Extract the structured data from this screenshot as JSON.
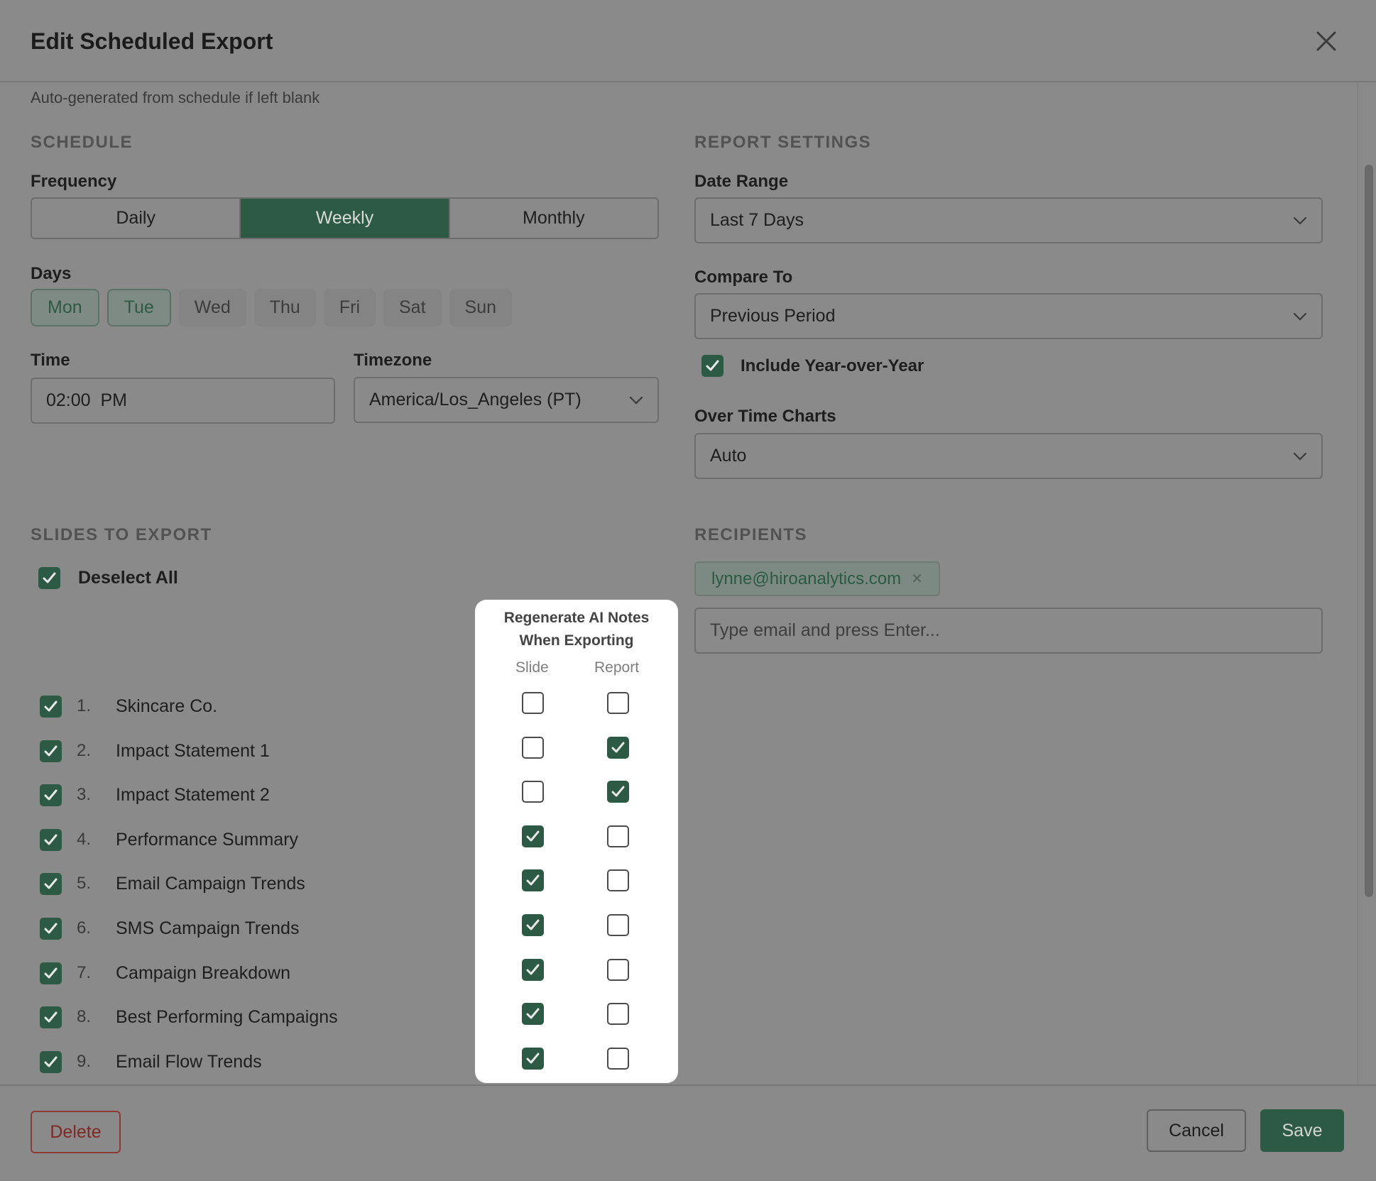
{
  "dialog": {
    "title": "Edit Scheduled Export",
    "name_hint": "Auto-generated from schedule if left blank"
  },
  "schedule": {
    "heading": "SCHEDULE",
    "frequency_label": "Frequency",
    "frequency_options": [
      "Daily",
      "Weekly",
      "Monthly"
    ],
    "frequency_selected": "Weekly",
    "days_label": "Days",
    "days": [
      {
        "label": "Mon",
        "selected": true
      },
      {
        "label": "Tue",
        "selected": true
      },
      {
        "label": "Wed",
        "selected": false
      },
      {
        "label": "Thu",
        "selected": false
      },
      {
        "label": "Fri",
        "selected": false
      },
      {
        "label": "Sat",
        "selected": false
      },
      {
        "label": "Sun",
        "selected": false
      }
    ],
    "time_label": "Time",
    "time_value": "02:00  PM",
    "timezone_label": "Timezone",
    "timezone_value": "America/Los_Angeles (PT)"
  },
  "report_settings": {
    "heading": "REPORT SETTINGS",
    "date_range_label": "Date Range",
    "date_range_value": "Last 7 Days",
    "compare_label": "Compare To",
    "compare_value": "Previous Period",
    "yoy_label": "Include Year-over-Year",
    "yoy_checked": true,
    "over_time_label": "Over Time Charts",
    "over_time_value": "Auto"
  },
  "slides": {
    "heading": "SLIDES TO EXPORT",
    "deselect_label": "Deselect All",
    "deselect_checked": true,
    "items": [
      {
        "num": "1.",
        "name": "Skincare Co.",
        "checked": true,
        "ai_slide": false,
        "ai_report": false
      },
      {
        "num": "2.",
        "name": "Impact Statement 1",
        "checked": true,
        "ai_slide": false,
        "ai_report": true
      },
      {
        "num": "3.",
        "name": "Impact Statement 2",
        "checked": true,
        "ai_slide": false,
        "ai_report": true
      },
      {
        "num": "4.",
        "name": "Performance Summary",
        "checked": true,
        "ai_slide": true,
        "ai_report": false
      },
      {
        "num": "5.",
        "name": "Email Campaign Trends",
        "checked": true,
        "ai_slide": true,
        "ai_report": false
      },
      {
        "num": "6.",
        "name": "SMS Campaign Trends",
        "checked": true,
        "ai_slide": true,
        "ai_report": false
      },
      {
        "num": "7.",
        "name": "Campaign Breakdown",
        "checked": true,
        "ai_slide": true,
        "ai_report": false
      },
      {
        "num": "8.",
        "name": "Best Performing Campaigns",
        "checked": true,
        "ai_slide": true,
        "ai_report": false
      },
      {
        "num": "9.",
        "name": "Email Flow Trends",
        "checked": true,
        "ai_slide": true,
        "ai_report": false
      }
    ]
  },
  "ai_notes": {
    "title_line1": "Regenerate AI Notes",
    "title_line2": "When Exporting",
    "col_slide": "Slide",
    "col_report": "Report"
  },
  "recipients": {
    "heading": "RECIPIENTS",
    "chips": [
      "lynne@hiroanalytics.com"
    ],
    "input_placeholder": "Type email and press Enter..."
  },
  "footer": {
    "delete_label": "Delete",
    "cancel_label": "Cancel",
    "save_label": "Save"
  },
  "colors": {
    "accent": "#2d5a45",
    "danger": "#8c3a35",
    "overlay": "#8a8a8a"
  }
}
